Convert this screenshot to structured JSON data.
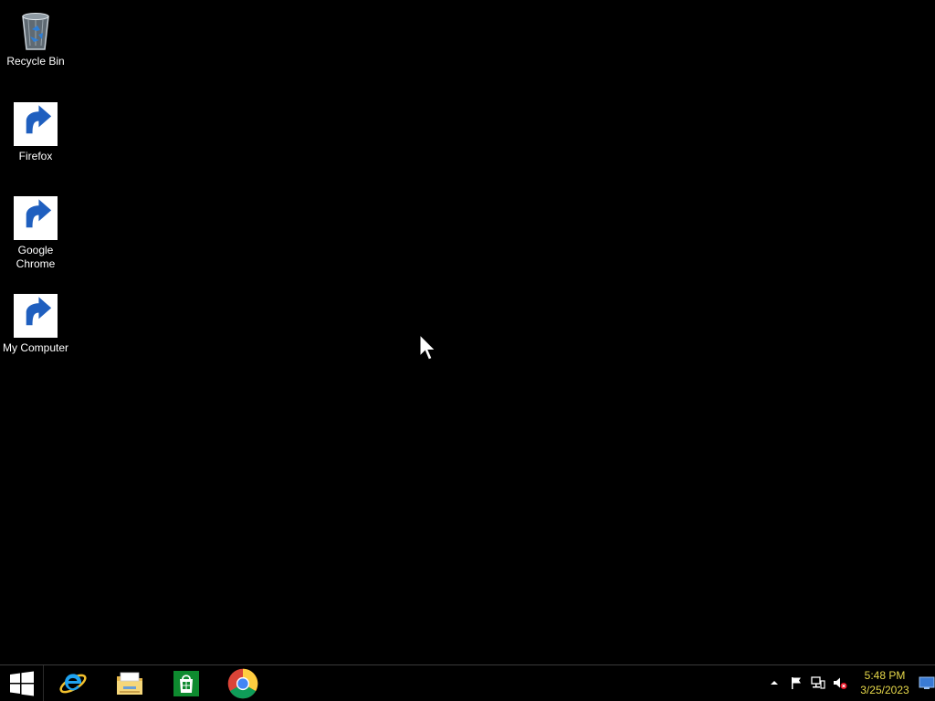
{
  "desktop": {
    "icons": [
      {
        "label": "Recycle Bin",
        "icon": "recycle-bin-icon"
      },
      {
        "label": "Firefox",
        "icon": "firefox-icon"
      },
      {
        "label": "Google Chrome",
        "icon": "chrome-icon"
      },
      {
        "label": "My Computer",
        "icon": "computer-icon"
      }
    ]
  },
  "taskbar": {
    "start_icon": "windows-logo-icon",
    "pinned": [
      {
        "name": "Internet Explorer",
        "icon": "internet-explorer-icon"
      },
      {
        "name": "File Explorer",
        "icon": "file-explorer-icon"
      },
      {
        "name": "Store",
        "icon": "store-icon"
      },
      {
        "name": "Google Chrome",
        "icon": "chrome-icon"
      }
    ],
    "tray": {
      "icons": [
        "show-hidden-icons-chevron",
        "action-center-flag-icon",
        "network-icon",
        "volume-muted-icon"
      ],
      "time": "5:48 PM",
      "date": "3/25/2023"
    }
  },
  "colors": {
    "desktop_background": "#000000",
    "clock_text": "#e6d84a",
    "taskbar_background": "#000000"
  }
}
